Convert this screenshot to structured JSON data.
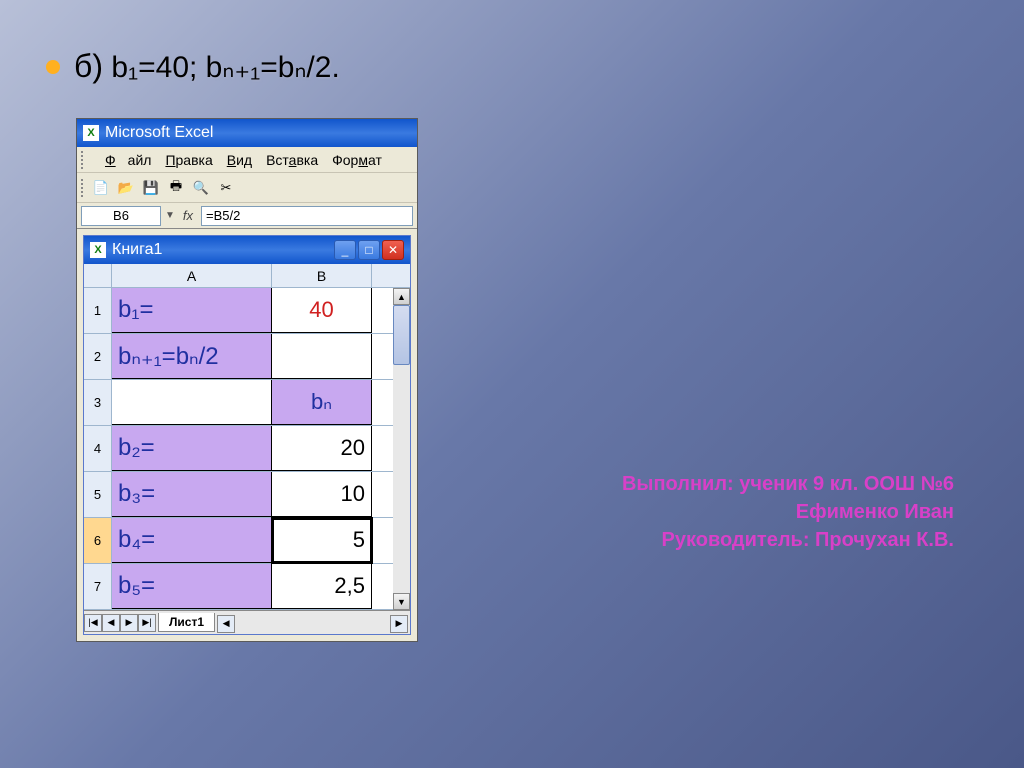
{
  "slide": {
    "bullet_prefix": "б)",
    "formula_text": " b₁=40; bₙ₊₁=bₙ/2."
  },
  "credits": {
    "line1": "Выполнил: ученик 9 кл. ООШ №6",
    "line2": "Ефименко Иван",
    "line3": "Руководитель: Прочухан К.В."
  },
  "app": {
    "title": "Microsoft Excel",
    "menu": {
      "file": "Файл",
      "edit": "Правка",
      "view": "Вид",
      "insert": "Вставка",
      "format": "Формат"
    },
    "namebox": "B6",
    "formula": "=B5/2",
    "workbook_title": "Книга1",
    "col_a": "A",
    "col_b": "B",
    "rows": [
      "1",
      "2",
      "3",
      "4",
      "5",
      "6",
      "7"
    ],
    "cells": {
      "a1": "b₁=",
      "b1": "40",
      "a2": "bₙ₊₁=bₙ/2",
      "b2": "",
      "a3": "",
      "b3": "bₙ",
      "a4": "b₂=",
      "b4": "20",
      "a5": "b₃=",
      "b5": "10",
      "a6": "b₄=",
      "b6": "5",
      "a7": "b₅=",
      "b7": "2,5"
    },
    "sheet_tab": "Лист1"
  }
}
